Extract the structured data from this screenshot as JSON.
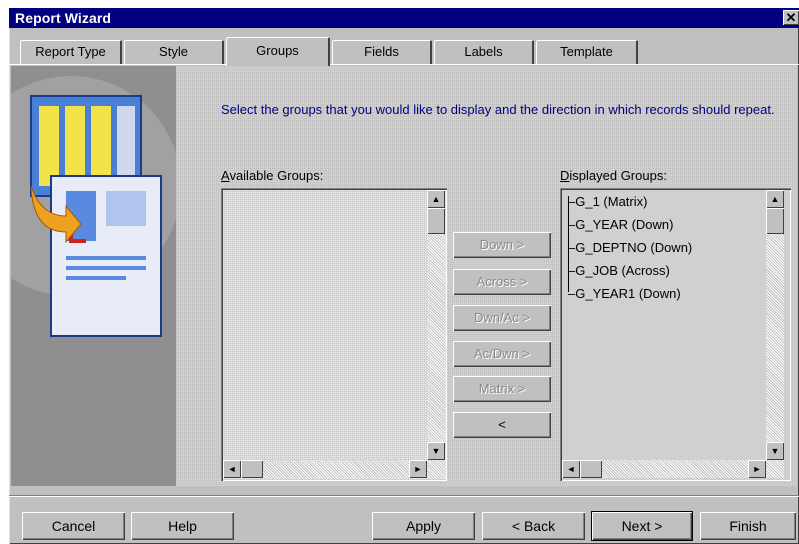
{
  "window": {
    "title": "Report Wizard",
    "close_glyph": "✕"
  },
  "tabs": [
    {
      "label": "Report Type",
      "active": false
    },
    {
      "label": "Style",
      "active": false
    },
    {
      "label": "Groups",
      "active": true
    },
    {
      "label": "Fields",
      "active": false
    },
    {
      "label": "Labels",
      "active": false
    },
    {
      "label": "Template",
      "active": false
    }
  ],
  "instructions": "Select the groups that you would like to display and the direction in which records should repeat.",
  "available": {
    "label_prefix": "A",
    "label_rest": "vailable Groups:",
    "items": []
  },
  "displayed": {
    "label_prefix": "D",
    "label_rest": "isplayed Groups:",
    "items": [
      "G_1 (Matrix)",
      "G_YEAR (Down)",
      "G_DEPTNO (Down)",
      "G_JOB (Across)",
      "G_YEAR1 (Down)"
    ]
  },
  "move_buttons": [
    {
      "label": "Down >",
      "enabled": false
    },
    {
      "label": "Across >",
      "enabled": false
    },
    {
      "label": "Dwn/Ac >",
      "enabled": false
    },
    {
      "label": "Ac/Dwn >",
      "enabled": false
    },
    {
      "label": "Matrix >",
      "enabled": false
    },
    {
      "label": "<",
      "enabled": true
    }
  ],
  "footer": {
    "cancel": "Cancel",
    "help": "Help",
    "apply": "Apply",
    "back": "< Back",
    "next": "Next >",
    "finish": "Finish"
  },
  "icons": {
    "art": "report-wizard-illustration",
    "scroll_up": "▲",
    "scroll_down": "▼",
    "scroll_left": "◄",
    "scroll_right": "►"
  }
}
